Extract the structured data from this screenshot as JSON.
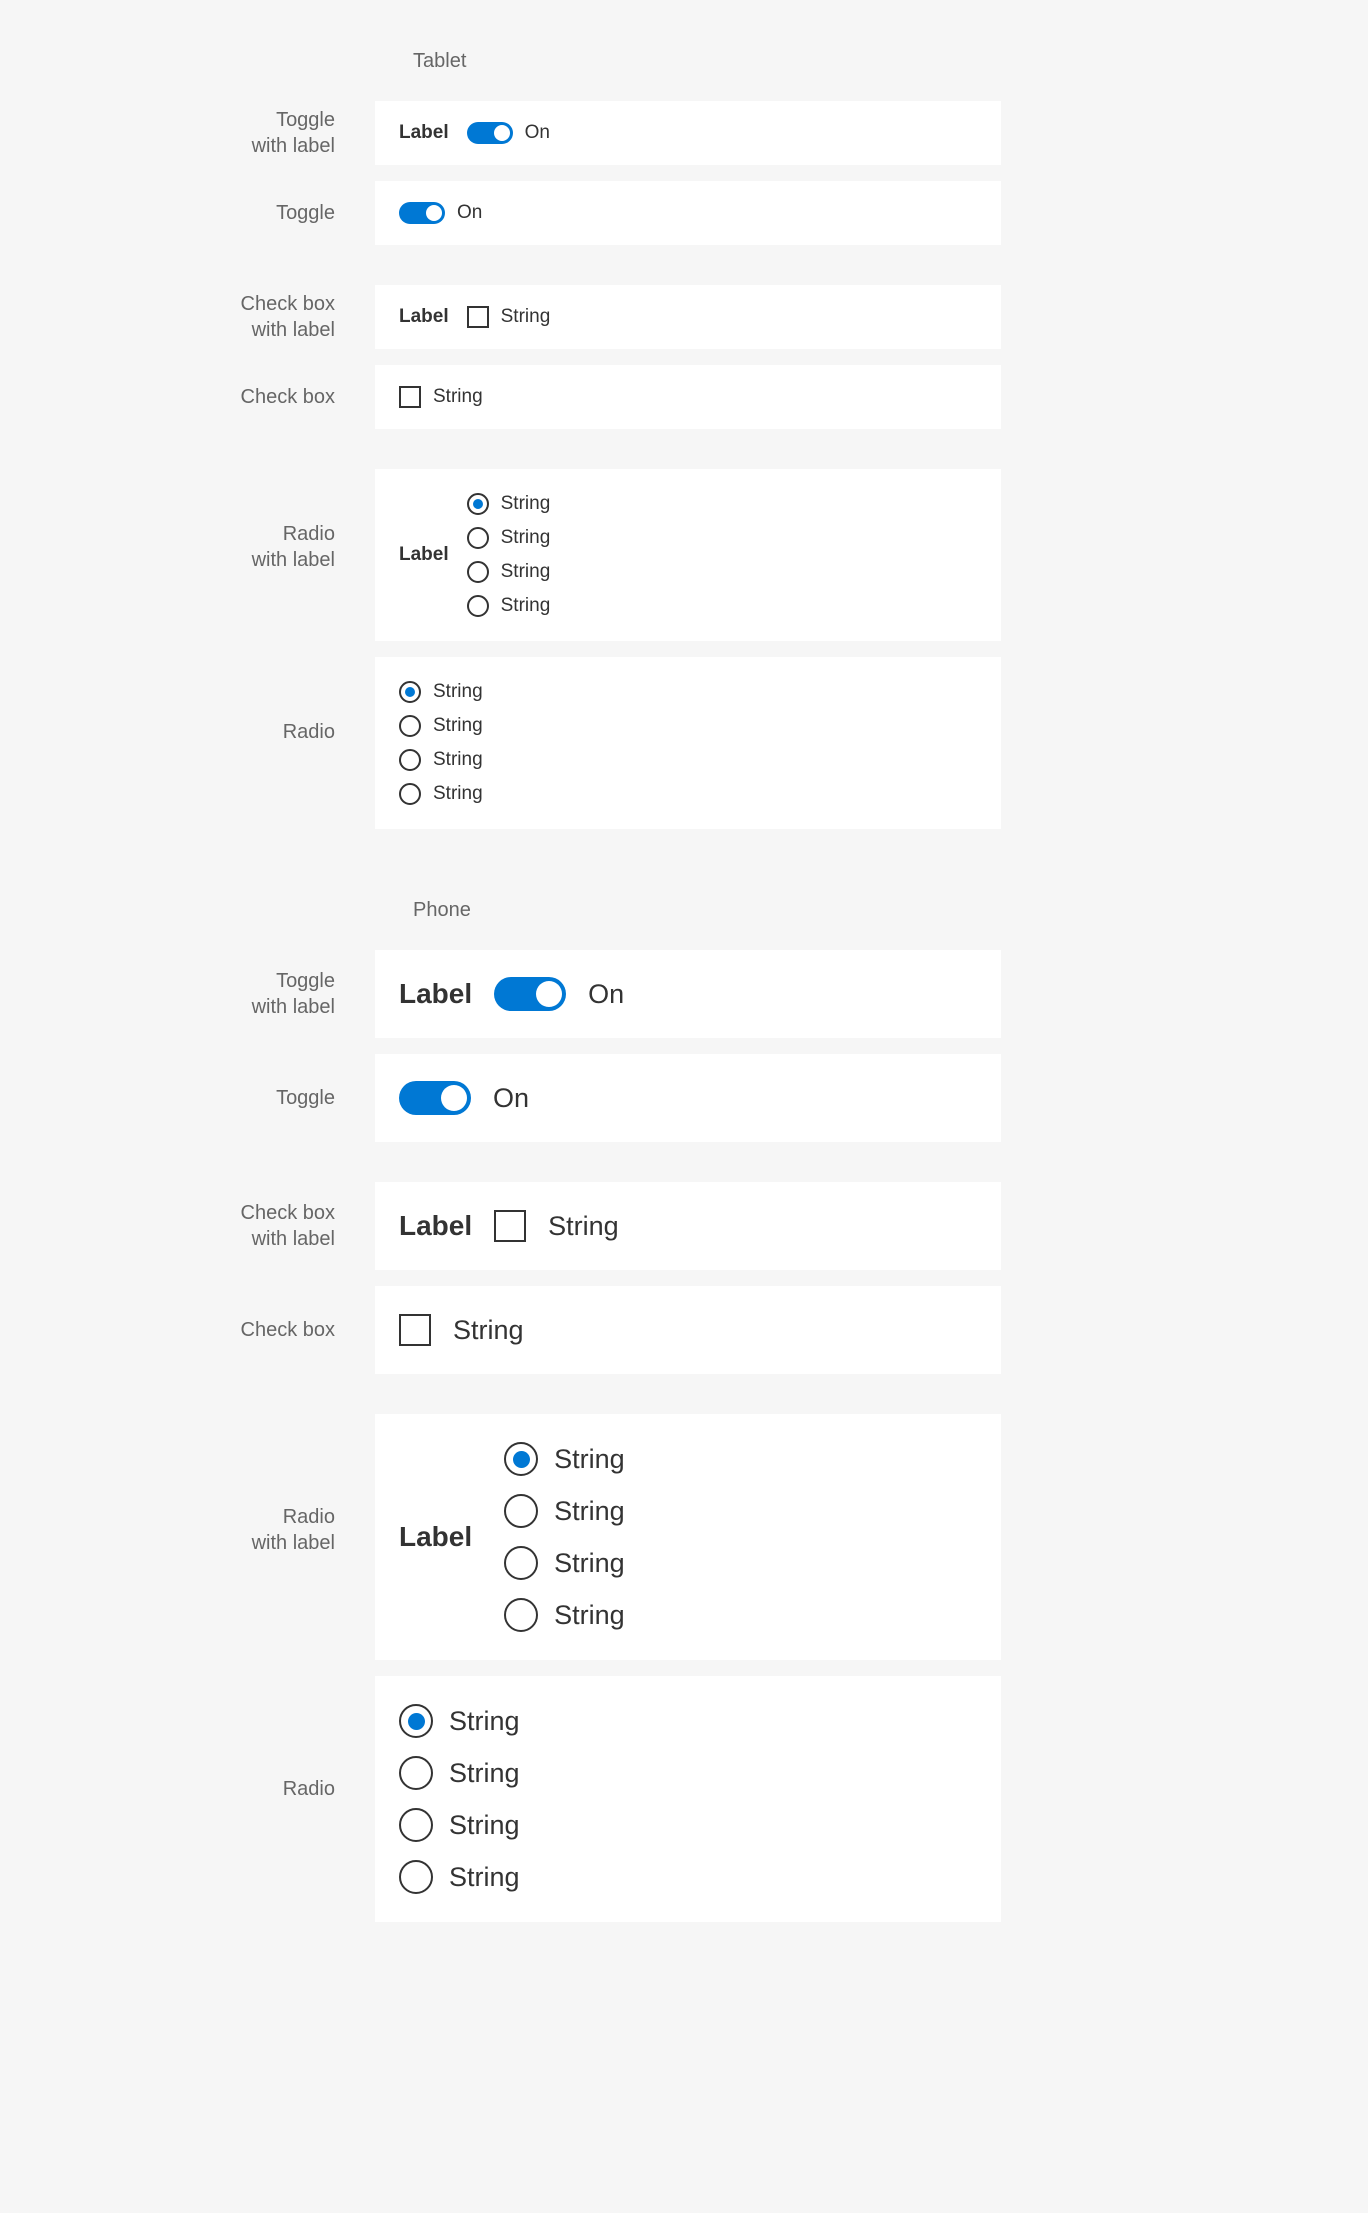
{
  "headings": {
    "tablet": "Tablet",
    "phone": "Phone"
  },
  "rowLabels": {
    "toggleWithLabel": "Toggle\nwith label",
    "toggle": "Toggle",
    "checkboxWithLabel": "Check box\nwith label",
    "checkbox": "Check box",
    "radioWithLabel": "Radio\nwith label",
    "radio": "Radio"
  },
  "tablet": {
    "toggleWithLabel": {
      "label": "Label",
      "state": "On"
    },
    "toggle": {
      "state": "On"
    },
    "checkboxWithLabel": {
      "label": "Label",
      "text": "String"
    },
    "checkbox": {
      "text": "String"
    },
    "radioWithLabel": {
      "label": "Label",
      "options": [
        {
          "text": "String",
          "selected": true
        },
        {
          "text": "String",
          "selected": false
        },
        {
          "text": "String",
          "selected": false
        },
        {
          "text": "String",
          "selected": false
        }
      ]
    },
    "radio": {
      "options": [
        {
          "text": "String",
          "selected": true
        },
        {
          "text": "String",
          "selected": false
        },
        {
          "text": "String",
          "selected": false
        },
        {
          "text": "String",
          "selected": false
        }
      ]
    }
  },
  "phone": {
    "toggleWithLabel": {
      "label": "Label",
      "state": "On"
    },
    "toggle": {
      "state": "On"
    },
    "checkboxWithLabel": {
      "label": "Label",
      "text": "String"
    },
    "checkbox": {
      "text": "String"
    },
    "radioWithLabel": {
      "label": "Label",
      "options": [
        {
          "text": "String",
          "selected": true
        },
        {
          "text": "String",
          "selected": false
        },
        {
          "text": "String",
          "selected": false
        },
        {
          "text": "String",
          "selected": false
        }
      ]
    },
    "radio": {
      "options": [
        {
          "text": "String",
          "selected": true
        },
        {
          "text": "String",
          "selected": false
        },
        {
          "text": "String",
          "selected": false
        },
        {
          "text": "String",
          "selected": false
        }
      ]
    }
  },
  "colors": {
    "accent": "#0078d4"
  }
}
